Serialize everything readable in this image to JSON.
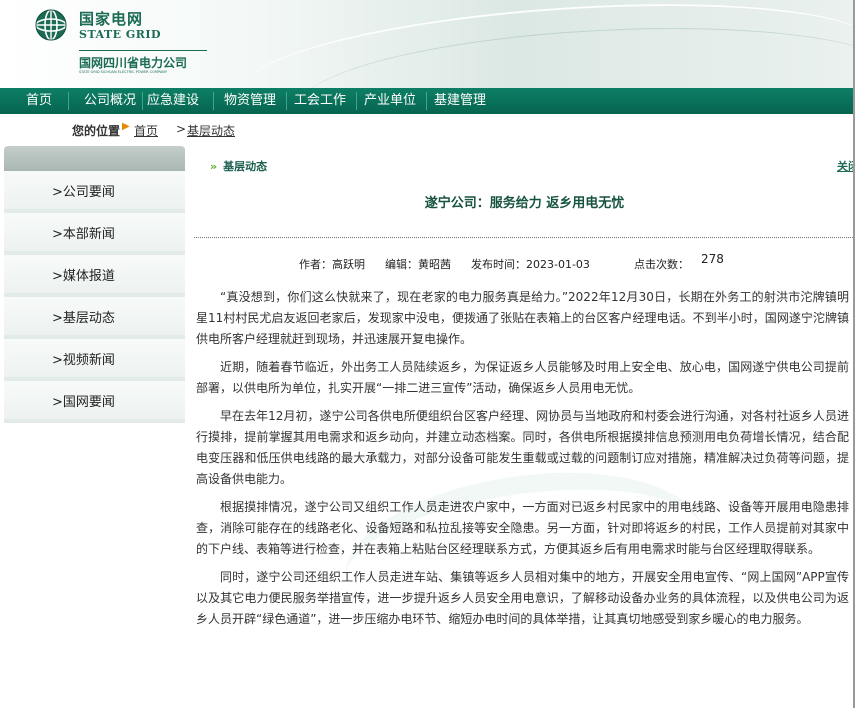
{
  "header": {
    "logo_cn": "国家电网",
    "logo_en": "STATE GRID",
    "company": "国网四川省电力公司",
    "company_en": "STATE GRID SICHUAN ELECTRIC POWER COMPANY"
  },
  "nav": {
    "items": [
      "首页",
      "公司概况",
      "应急建设",
      "物资管理",
      "工会工作",
      "产业单位",
      "基建管理"
    ]
  },
  "breadcrumb": {
    "label": "您的位置",
    "home": "首页",
    "separator": ">",
    "current": "基层动态"
  },
  "sidebar": {
    "items": [
      "公司要闻",
      "本部新闻",
      "媒体报道",
      "基层动态",
      "视频新闻",
      "国网要闻"
    ],
    "prefix": ">"
  },
  "article": {
    "section": "基层动态",
    "close_link": "关闭",
    "title": "遂宁公司：服务给力 返乡用电无忧",
    "meta": {
      "author": "作者：高跃明",
      "editor": "编辑：黄昭茜",
      "published": "发布时间：2023-01-03",
      "clicks_label": "点击次数：",
      "clicks": "278"
    },
    "paragraphs": [
      "“真没想到，你们这么快就来了，现在老家的电力服务真是给力。”2022年12月30日，长期在外务工的射洪市沱牌镇明星11村村民尤启友返回老家后，发现家中没电，便拨通了张贴在表箱上的台区客户经理电话。不到半小时，国网遂宁沱牌镇供电所客户经理就赶到现场，并迅速展开复电操作。",
      "近期，随着春节临近，外出务工人员陆续返乡，为保证返乡人员能够及时用上安全电、放心电，国网遂宁供电公司提前部署，以供电所为单位，扎实开展“一排二进三宣传”活动，确保返乡人员用电无忧。",
      "早在去年12月初，遂宁公司各供电所便组织台区客户经理、网协员与当地政府和村委会进行沟通，对各村社返乡人员进行摸排，提前掌握其用电需求和返乡动向，并建立动态档案。同时，各供电所根据摸排信息预测用电负荷增长情况，结合配电变压器和低压供电线路的最大承载力，对部分设备可能发生重载或过载的问题制订应对措施，精准解决过负荷等问题，提高设备供电能力。",
      "根据摸排情况，遂宁公司又组织工作人员走进农户家中，一方面对已返乡村民家中的用电线路、设备等开展用电隐患排查，消除可能存在的线路老化、设备短路和私拉乱接等安全隐患。另一方面，针对即将返乡的村民，工作人员提前对其家中的下户线、表箱等进行检查，并在表箱上粘贴台区经理联系方式，方便其返乡后有用电需求时能与台区经理取得联系。",
      "同时，遂宁公司还组织工作人员走进车站、集镇等返乡人员相对集中的地方，开展安全用电宣传、“网上国网”APP宣传以及其它电力便民服务举措宣传，进一步提升返乡人员安全用电意识，了解移动设备办业务的具体流程，以及供电公司为返乡人员开辟“绿色通道”，进一步压缩办电环节、缩短办电时间的具体举措，让其真切地感受到家乡暖心的电力服务。"
    ]
  }
}
